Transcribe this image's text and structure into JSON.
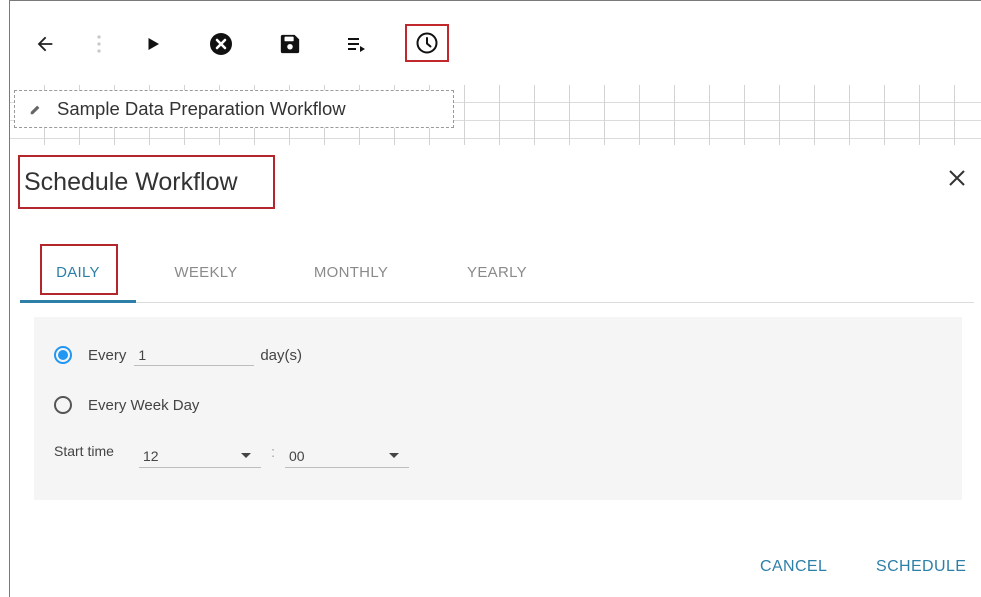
{
  "toolbar": {
    "icons": [
      "back-arrow-icon",
      "drag-handle-icon",
      "play-icon",
      "cancel-circle-icon",
      "save-icon",
      "playlist-play-icon",
      "clock-icon"
    ],
    "highlight_color": "#c0282d"
  },
  "workflow": {
    "name": "Sample Data Preparation Workflow"
  },
  "dialog": {
    "title": "Schedule Workflow",
    "tabs": [
      {
        "label": "DAILY",
        "active": true
      },
      {
        "label": "WEEKLY",
        "active": false
      },
      {
        "label": "MONTHLY",
        "active": false
      },
      {
        "label": "YEARLY",
        "active": false
      }
    ],
    "daily": {
      "every_label": "Every",
      "every_value": "1",
      "every_unit": "day(s)",
      "weekday_label": "Every Week Day",
      "start_time_label": "Start time",
      "hour": "12",
      "separator": ":",
      "minute": "00",
      "selected_option": "every"
    },
    "actions": {
      "cancel": "CANCEL",
      "schedule": "SCHEDULE"
    },
    "accent_color": "#2d7fa8",
    "radio_color": "#2196f3"
  }
}
